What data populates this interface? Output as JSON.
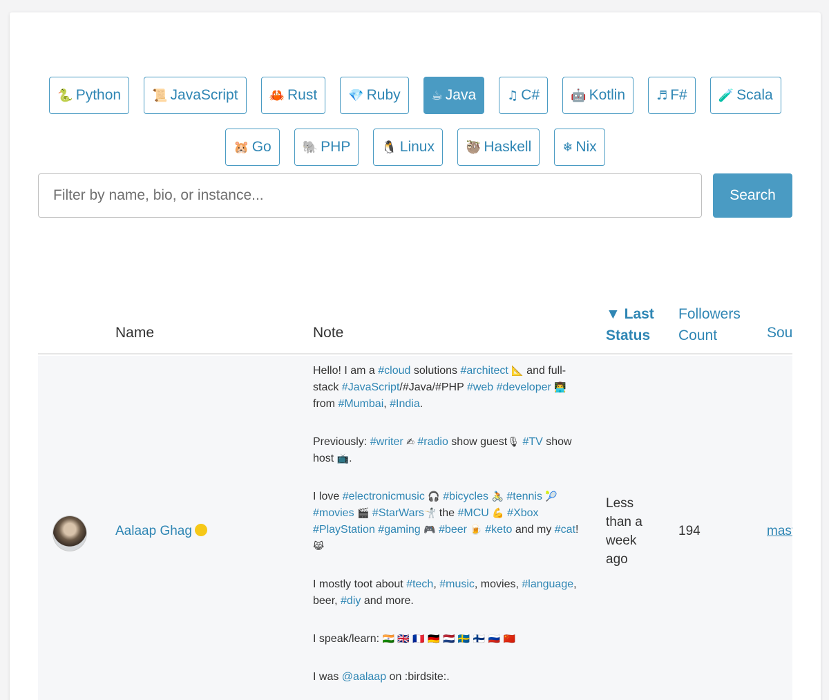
{
  "languages_row1": [
    {
      "icon": "🐍",
      "label": "Python",
      "active": false
    },
    {
      "icon": "📜",
      "label": "JavaScript",
      "active": false
    },
    {
      "icon": "🦀",
      "label": "Rust",
      "active": false
    },
    {
      "icon": "💎",
      "label": "Ruby",
      "active": false
    },
    {
      "icon": "☕",
      "label": "Java",
      "active": true
    },
    {
      "icon": "♫",
      "label": "C#",
      "active": false
    },
    {
      "icon": "🤖",
      "label": "Kotlin",
      "active": false
    },
    {
      "icon": "♬",
      "label": "F#",
      "active": false
    },
    {
      "icon": "🧪",
      "label": "Scala",
      "active": false
    }
  ],
  "languages_row2": [
    {
      "icon": "🐹",
      "label": "Go",
      "active": false
    },
    {
      "icon": "🐘",
      "label": "PHP",
      "active": false
    },
    {
      "icon": "🐧",
      "label": "Linux",
      "active": false
    },
    {
      "icon": "🦥",
      "label": "Haskell",
      "active": false
    },
    {
      "icon": "❄",
      "label": "Nix",
      "active": false
    }
  ],
  "search": {
    "placeholder": "Filter by name, bio, or instance...",
    "button_label": "Search"
  },
  "table": {
    "headers": {
      "name": "Name",
      "note": "Note",
      "last_status_line1": "▼ Last",
      "last_status_line2": "Status",
      "followers_line1": "Followers",
      "followers_line2": "Count",
      "source": "Sou"
    },
    "row": {
      "name": "Aalaap Ghag",
      "last_status_line1": "Less",
      "last_status_line2": "than a",
      "last_status_line3": "week",
      "last_status_line4": "ago",
      "followers": "194",
      "source": "mast"
    }
  },
  "colors": {
    "accent": "#4a9bc3",
    "link": "#2f86b4",
    "status_dot": "#f6c818"
  }
}
